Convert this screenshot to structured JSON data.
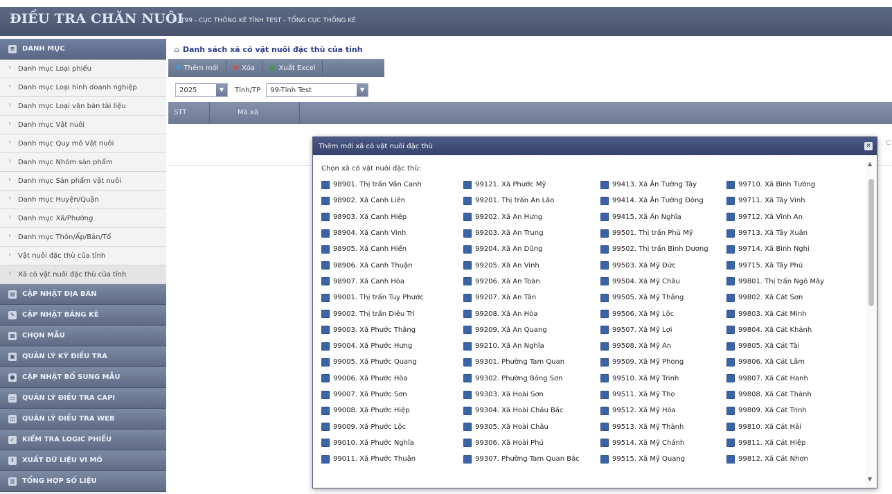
{
  "header": {
    "app_title": "ĐIỀU TRA CHĂN NUÔI",
    "org_text": "T99 - CỤC THỐNG KÊ TỈNH TEST - TỔNG CỤC THỐNG KÊ",
    "copyright_symbol": "©"
  },
  "sidebar": {
    "groups": [
      {
        "label": "DANH MỤC",
        "icon": "list-icon"
      },
      {
        "label": "CẬP NHẬT ĐỊA BÀN",
        "icon": "map-icon"
      },
      {
        "label": "CẬP NHẬT BẢNG KÊ",
        "icon": "edit-icon"
      },
      {
        "label": "CHỌN MẪU",
        "icon": "grid-icon"
      },
      {
        "label": "QUẢN LÝ KỲ ĐIỀU TRA",
        "icon": "calendar-icon"
      },
      {
        "label": "CẬP NHẬT BỔ SUNG MẪU",
        "icon": "bulb-icon"
      },
      {
        "label": "QUẢN LÝ ĐIỀU TRA CAPI",
        "icon": "tablet-icon"
      },
      {
        "label": "QUẢN LÝ ĐIỀU TRA WEB",
        "icon": "web-icon"
      },
      {
        "label": "KIỂM TRA LOGIC PHIẾU",
        "icon": "check-icon"
      },
      {
        "label": "XUẤT DỮ LIỆU VI MÔ",
        "icon": "export-icon"
      },
      {
        "label": "TỔNG HỢP SỐ LIỆU",
        "icon": "report-icon"
      }
    ],
    "items": [
      "Danh mục Loại phiếu",
      "Danh mục Loại hình doanh nghiệp",
      "Danh mục Loại văn bản tài liệu",
      "Danh mục Vật nuôi",
      "Danh mục Quy mô Vật nuôi",
      "Danh mục Nhóm sản phẩm",
      "Danh mục Sản phẩm vật nuôi",
      "Danh mục Huyện/Quận",
      "Danh mục Xã/Phường",
      "Danh mục Thôn/Ấp/Bản/Tổ",
      "Vật nuôi đặc thù của tỉnh",
      "Xã có vật nuôi đặc thù của tỉnh"
    ],
    "active_item_index": 11
  },
  "main": {
    "heading": "Danh sách xã có vật nuôi đặc thù của tỉnh",
    "toolbar": {
      "add_label": "Thêm mới",
      "delete_label": "Xóa",
      "export_label": "Xuất Excel"
    },
    "filters": {
      "year_value": "2025",
      "province_label": "Tỉnh/TP",
      "province_value": "99-Tỉnh Test"
    },
    "grid": {
      "columns": [
        "STT",
        "Mã xã"
      ]
    },
    "page_peek": "C"
  },
  "dialog": {
    "title": "Thêm mới xã có vật nuôi đặc thù",
    "close_symbol": "✕",
    "label": "Chọn xã có vật nuôi đặc thù:",
    "columns": [
      [
        "98901. Thị trấn Vân Canh",
        "98902. Xã Canh Liên",
        "98903. Xã Canh Hiệp",
        "98904. Xã Canh Vinh",
        "98905. Xã Canh Hiển",
        "98906. Xã Canh Thuận",
        "98907. Xã Canh Hòa",
        "99001. Thị trấn Tuy Phước",
        "99002. Thị trấn Diêu Trì",
        "99003. Xã Phước Thắng",
        "99004. Xã Phước Hưng",
        "99005. Xã Phước Quang",
        "99006. Xã Phước Hòa",
        "99007. Xã Phước Sơn",
        "99008. Xã Phước Hiệp",
        "99009. Xã Phước Lộc",
        "99010. Xã Phước Nghĩa",
        "99011. Xã Phước Thuận"
      ],
      [
        "99121. Xã Phước Mỹ",
        "99201. Thị trấn An Lão",
        "99202. Xã An Hưng",
        "99203. Xã An Trung",
        "99204. Xã An Dũng",
        "99205. Xã An Vinh",
        "99206. Xã An Toàn",
        "99207. Xã An Tân",
        "99208. Xã An Hòa",
        "99209. Xã An Quang",
        "99210. Xã An Nghĩa",
        "99301. Phường Tam Quan",
        "99302. Phường Bồng Sơn",
        "99303. Xã Hoài Sơn",
        "99304. Xã Hoài Châu Bắc",
        "99305. Xã Hoài Châu",
        "99306. Xã Hoài Phú",
        "99307. Phường Tam Quan Bắc"
      ],
      [
        "99413. Xã Ân Tường Tây",
        "99414. Xã Ân Tường Đông",
        "99415. Xã Ân Nghĩa",
        "99501. Thị trấn Phù Mỹ",
        "99502. Thị trấn Bình Dương",
        "99503. Xã Mỹ Đức",
        "99504. Xã Mỹ Châu",
        "99505. Xã Mỹ Thắng",
        "99506. Xã Mỹ Lộc",
        "99507. Xã Mỹ Lợi",
        "99508. Xã Mỹ An",
        "99509. Xã Mỹ Phong",
        "99510. Xã Mỹ Trinh",
        "99511. Xã Mỹ Thọ",
        "99512. Xã Mỹ Hòa",
        "99513. Xã Mỹ Thành",
        "99514. Xã Mỹ Chánh",
        "99515. Xã Mỹ Quang"
      ],
      [
        "99710. Xã Bình Tường",
        "99711. Xã Tây Vinh",
        "99712. Xã Vĩnh An",
        "99713. Xã Tây Xuân",
        "99714. Xã Bình Nghi",
        "99715. Xã Tây Phú",
        "99801. Thị trấn Ngô Mây",
        "99802. Xã Cát Sơn",
        "99803. Xã Cát Minh",
        "99804. Xã Cát Khánh",
        "99805. Xã Cát Tài",
        "99806. Xã Cát Lâm",
        "99807. Xã Cát Hanh",
        "99808. Xã Cát Thành",
        "99809. Xã Cát Trinh",
        "99810. Xã Cát Hải",
        "99811. Xã Cát Hiệp",
        "99812. Xã Cát Nhơn"
      ]
    ]
  },
  "colors": {
    "header_bg": "#48536c",
    "accent": "#2c3c8c",
    "checkbox": "#3a63a8"
  }
}
